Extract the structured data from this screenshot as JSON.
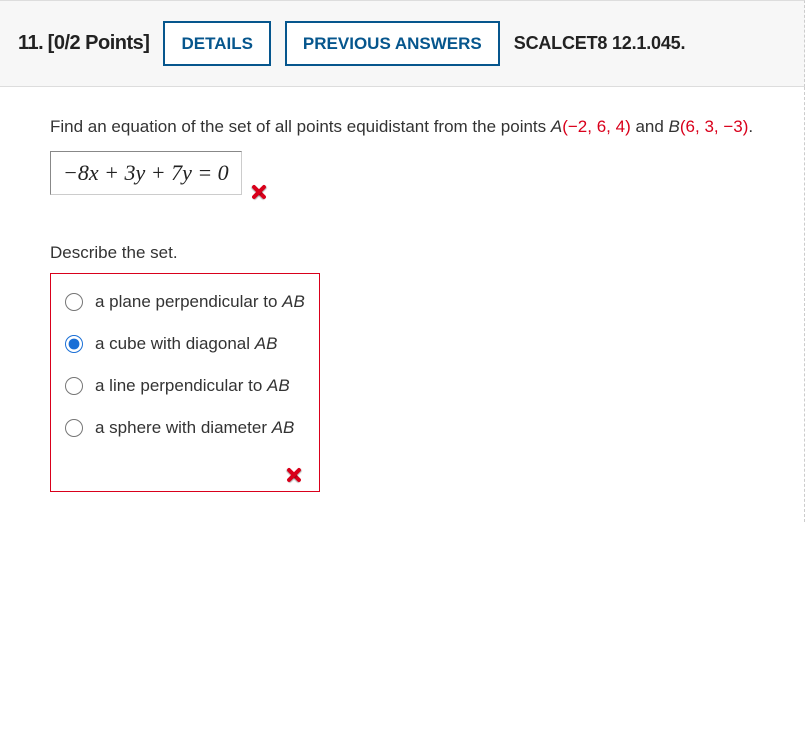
{
  "header": {
    "question_number": "11.",
    "points_label": "[0/2 Points]",
    "details_label": "DETAILS",
    "previous_label": "PREVIOUS ANSWERS",
    "textbook_ref": "SCALCET8 12.1.045."
  },
  "question": {
    "prompt_prefix": "Find an equation of the set of all points equidistant from the points ",
    "point_a_label": "A",
    "point_a_coords": "(−2, 6, 4)",
    "between": " and ",
    "point_b_label": "B",
    "point_b_coords": "(6, 3, −3)",
    "prompt_suffix": "."
  },
  "answer": {
    "expression": "−8x + 3y + 7y = 0",
    "correct": false
  },
  "describe": {
    "label": "Describe the set.",
    "options": [
      {
        "text_pre": "a plane perpendicular to ",
        "ital": "AB",
        "selected": false
      },
      {
        "text_pre": "a cube with diagonal ",
        "ital": "AB",
        "selected": true
      },
      {
        "text_pre": "a line perpendicular to ",
        "ital": "AB",
        "selected": false
      },
      {
        "text_pre": "a sphere with diameter ",
        "ital": "AB",
        "selected": false
      }
    ],
    "correct": false
  }
}
